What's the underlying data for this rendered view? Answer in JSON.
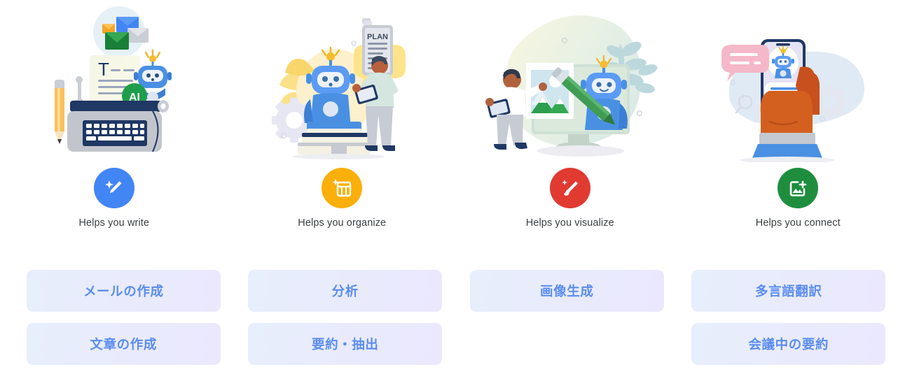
{
  "features": [
    {
      "id": "write",
      "illustration_name": "typewriter-email-robot-illustration",
      "icon_name": "magic-pencil-icon",
      "icon_color": "#4285f4",
      "label": "Helps you write"
    },
    {
      "id": "organize",
      "illustration_name": "robot-books-plan-person-illustration",
      "icon_name": "magic-table-icon",
      "icon_color": "#fbaf0b",
      "label": "Helps you organize"
    },
    {
      "id": "visualize",
      "illustration_name": "monitor-image-robot-brush-illustration",
      "icon_name": "magic-brush-icon",
      "icon_color": "#e03a31",
      "label": "Helps you visualize"
    },
    {
      "id": "connect",
      "illustration_name": "hand-phone-chatbot-illustration",
      "icon_name": "add-image-icon",
      "icon_color": "#1e8e3e",
      "label": "Helps you connect"
    }
  ],
  "chip_columns": [
    {
      "chips": [
        "メールの作成",
        "文章の作成"
      ]
    },
    {
      "chips": [
        "分析",
        "要約・抽出"
      ]
    },
    {
      "chips": [
        "画像生成"
      ]
    },
    {
      "chips": [
        "多言語翻訳",
        "会議中の要約"
      ]
    }
  ],
  "illustration_text": {
    "ai_badge": "AI",
    "plan_clipboard": "PLAN",
    "document_letter": "T"
  },
  "colors": {
    "chip_text": "#5b8def",
    "chip_bg_start": "#e7eefc",
    "chip_bg_end": "#ebe8fe",
    "label_text": "#3c4043",
    "page_bg": "#ffffff"
  }
}
